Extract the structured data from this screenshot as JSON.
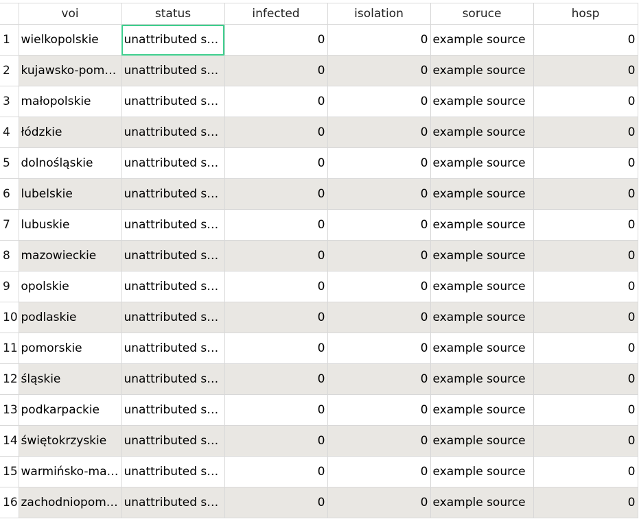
{
  "table": {
    "columns": [
      "voi",
      "status",
      "infected",
      "isolation",
      "soruce",
      "hosp"
    ],
    "rows": [
      {
        "id": "1",
        "voi": "wielkopolskie",
        "status": "unattributed sta…",
        "infected": "0",
        "isolation": "0",
        "soruce": "example source",
        "hosp": "0"
      },
      {
        "id": "2",
        "voi": "kujawsko-pomo…",
        "status": "unattributed sta…",
        "infected": "0",
        "isolation": "0",
        "soruce": "example source",
        "hosp": "0"
      },
      {
        "id": "3",
        "voi": "małopolskie",
        "status": "unattributed sta…",
        "infected": "0",
        "isolation": "0",
        "soruce": "example source",
        "hosp": "0"
      },
      {
        "id": "4",
        "voi": "łódzkie",
        "status": "unattributed sta…",
        "infected": "0",
        "isolation": "0",
        "soruce": "example source",
        "hosp": "0"
      },
      {
        "id": "5",
        "voi": "dolnośląskie",
        "status": "unattributed sta…",
        "infected": "0",
        "isolation": "0",
        "soruce": "example source",
        "hosp": "0"
      },
      {
        "id": "6",
        "voi": "lubelskie",
        "status": "unattributed sta…",
        "infected": "0",
        "isolation": "0",
        "soruce": "example source",
        "hosp": "0"
      },
      {
        "id": "7",
        "voi": "lubuskie",
        "status": "unattributed sta…",
        "infected": "0",
        "isolation": "0",
        "soruce": "example source",
        "hosp": "0"
      },
      {
        "id": "8",
        "voi": "mazowieckie",
        "status": "unattributed sta…",
        "infected": "0",
        "isolation": "0",
        "soruce": "example source",
        "hosp": "0"
      },
      {
        "id": "9",
        "voi": "opolskie",
        "status": "unattributed sta…",
        "infected": "0",
        "isolation": "0",
        "soruce": "example source",
        "hosp": "0"
      },
      {
        "id": "10",
        "voi": "podlaskie",
        "status": "unattributed sta…",
        "infected": "0",
        "isolation": "0",
        "soruce": "example source",
        "hosp": "0"
      },
      {
        "id": "11",
        "voi": "pomorskie",
        "status": "unattributed sta…",
        "infected": "0",
        "isolation": "0",
        "soruce": "example source",
        "hosp": "0"
      },
      {
        "id": "12",
        "voi": "śląskie",
        "status": "unattributed sta…",
        "infected": "0",
        "isolation": "0",
        "soruce": "example source",
        "hosp": "0"
      },
      {
        "id": "13",
        "voi": "podkarpackie",
        "status": "unattributed sta…",
        "infected": "0",
        "isolation": "0",
        "soruce": "example source",
        "hosp": "0"
      },
      {
        "id": "14",
        "voi": "świętokrzyskie",
        "status": "unattributed sta…",
        "infected": "0",
        "isolation": "0",
        "soruce": "example source",
        "hosp": "0"
      },
      {
        "id": "15",
        "voi": "warmińsko-maz…",
        "status": "unattributed sta…",
        "infected": "0",
        "isolation": "0",
        "soruce": "example source",
        "hosp": "0"
      },
      {
        "id": "16",
        "voi": "zachodniopom…",
        "status": "unattributed sta…",
        "infected": "0",
        "isolation": "0",
        "soruce": "example source",
        "hosp": "0"
      }
    ],
    "selected_row": 0,
    "selected_column": "status"
  },
  "colors": {
    "alt_row": "#e9e7e3",
    "selection_border": "#3ecf8e",
    "gridline": "#d8d8d8"
  }
}
